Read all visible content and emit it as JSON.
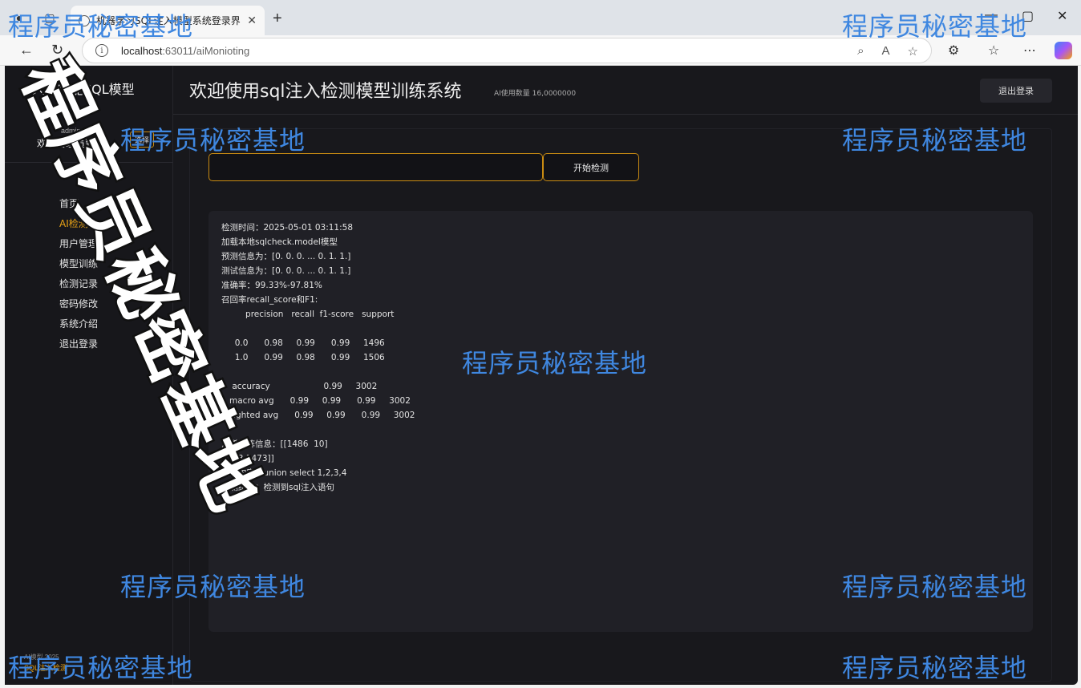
{
  "browser": {
    "tab_title": "机器学习SQL注入模型系统登录界",
    "url_host": "localhost",
    "url_rest": ":63011/aiMonioting"
  },
  "sidebar": {
    "brand": "人工智能SQL模型",
    "user_role": "admin",
    "welcome": "欢迎管理员到来",
    "role_button": "选择",
    "items": [
      {
        "label": "首页"
      },
      {
        "label": "AI检测"
      },
      {
        "label": "用户管理"
      },
      {
        "label": "模型训练"
      },
      {
        "label": "检测记录"
      },
      {
        "label": "密码修改"
      },
      {
        "label": "系统介绍"
      },
      {
        "label": "退出登录"
      }
    ],
    "footer": "AI模型 2025",
    "footer2": "SQL注入检测"
  },
  "header": {
    "title": "欢迎使用sql注入检测模型训练系统",
    "ai_count": "AI使用数量 16,0000000",
    "logout": "退出登录"
  },
  "detect": {
    "input_value": "",
    "button": "开始检测"
  },
  "result": {
    "lines": [
      "检测时间：2025-05-01 03:11:58",
      "加载本地sqlcheck.model模型",
      "预测信息为：[0. 0. 0. ... 0. 1. 1.]",
      "测试信息为：[0. 0. 0. ... 0. 1. 1.]",
      "准确率：99.33%-97.81%",
      "召回率recall_score和F1:",
      "         precision   recall  f1-score   support",
      "",
      "     0.0      0.98     0.99      0.99     1496",
      "     1.0      0.99     0.98      0.99     1506",
      "",
      "    accuracy                    0.99     3002",
      "   macro avg      0.99     0.99      0.99     3002",
      "weighted avg      0.99     0.99      0.99     3002",
      "",
      "混淆矩阵信息：[[1486  10]",
      " [  33 1473]]",
      "检测内容：union select 1,2,3,4",
      "检测结果：检测到sql注入语句"
    ]
  },
  "watermark": {
    "text": "程序员秘密基地"
  }
}
